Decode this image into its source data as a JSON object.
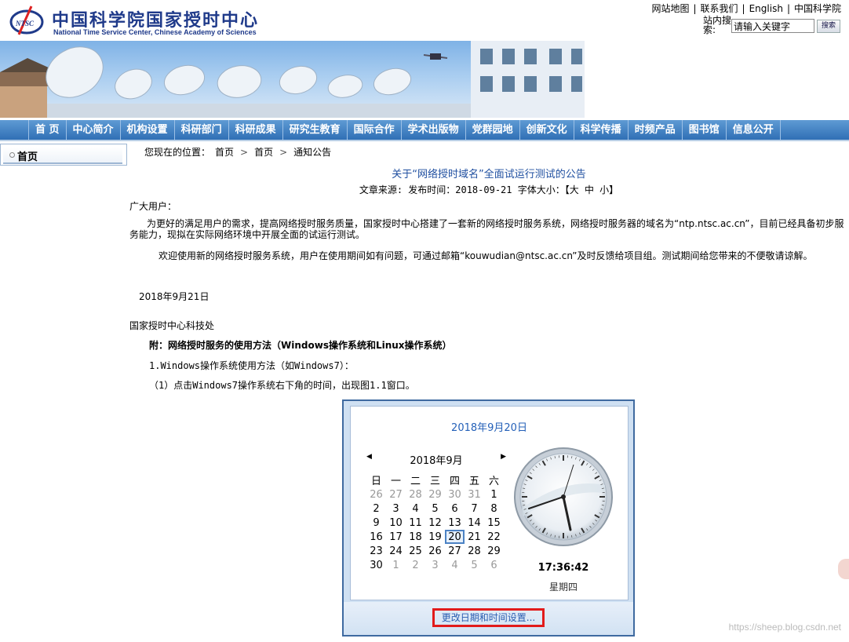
{
  "header": {
    "logo_cn": "中国科学院国家授时中心",
    "logo_en": "National Time Service Center, Chinese Academy of Sciences",
    "logo_badge": "NTSC",
    "links": [
      "网站地图",
      "联系我们",
      "English",
      "中国科学院"
    ],
    "search_label": "站内搜索:",
    "search_value": "请输入关键字",
    "search_button": "搜索"
  },
  "nav": [
    "首 页",
    "中心简介",
    "机构设置",
    "科研部门",
    "科研成果",
    "研究生教育",
    "国际合作",
    "学术出版物",
    "党群园地",
    "创新文化",
    "科学传播",
    "时频产品",
    "图书馆",
    "信息公开"
  ],
  "sidebar": {
    "item": "首页"
  },
  "breadcrumb": {
    "prefix": "您现在的位置：",
    "items": [
      "首页",
      "首页",
      "通知公告"
    ],
    "separator": ">"
  },
  "article": {
    "title": "关于“网络授时域名”全面试运行测试的公告",
    "meta": "文章来源:  发布时间：2018-09-21 字体大小：【大 中 小】",
    "greeting": "广大用户：",
    "body1": "为更好的满足用户的需求，提高网络授时服务质量，国家授时中心搭建了一套新的网络授时服务系统，网络授时服务器的域名为“ntp.ntsc.ac.cn”，目前已经具备初步服务能力，现拟在实际网络环境中开展全面的试运行测试。",
    "body2": "欢迎使用新的网络授时服务系统，用户在使用期间如有问题，可通过邮箱“kouwudian@ntsc.ac.cn”及时反馈给项目组。测试期间给您带来的不便敬请谅解。",
    "date": "2018年9月21日",
    "signature": "国家授时中心科技处",
    "attachment": "附：网络授时服务的使用方法（Windows操作系统和Linux操作系统）",
    "win_title": "1.Windows操作系统使用方法（如Windows7）：",
    "step1": "（1）点击Windows7操作系统右下角的时间，出现图1.1窗口。"
  },
  "screenshot": {
    "date_header": "2018年9月20日",
    "month": "2018年9月",
    "weekdays": [
      "日",
      "一",
      "二",
      "三",
      "四",
      "五",
      "六"
    ],
    "weeks": [
      [
        "26",
        "27",
        "28",
        "29",
        "30",
        "31",
        "1"
      ],
      [
        "2",
        "3",
        "4",
        "5",
        "6",
        "7",
        "8"
      ],
      [
        "9",
        "10",
        "11",
        "12",
        "13",
        "14",
        "15"
      ],
      [
        "16",
        "17",
        "18",
        "19",
        "20",
        "21",
        "22"
      ],
      [
        "23",
        "24",
        "25",
        "26",
        "27",
        "28",
        "29"
      ],
      [
        "30",
        "1",
        "2",
        "3",
        "4",
        "5",
        "6"
      ]
    ],
    "today": "20",
    "time": "17:36:42",
    "weekday": "星期四",
    "change_link": "更改日期和时间设置..."
  },
  "watermark": "https://sheep.blog.csdn.net",
  "colors": {
    "nav": "#2f6fb5",
    "title": "#1f4fa0",
    "highlight": "#e21b1b"
  }
}
